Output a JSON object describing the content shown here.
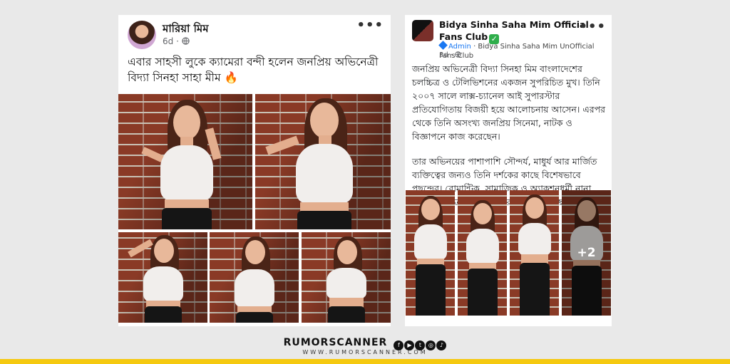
{
  "left_post": {
    "author": "মারিয়া মিম",
    "time": "6d",
    "privacy_icon": "globe-icon",
    "caption": "এবার সাহসী লুকে ক্যামেরা বন্দী হলেন জনপ্রিয় অভিনেত্রী বিদ্যা সিনহা সাহা মীম 🔥"
  },
  "right_post": {
    "page_name": "Bidya Sinha Saha Mim Official Fans Club",
    "verified_mark": "✓",
    "admin_label": "Admin",
    "admin_group": "Bidya Sinha Saha Mim UnOfficial Fans Club",
    "time": "3d",
    "privacy_icon": "globe-icon",
    "paragraph1": "জনপ্রিয় অভিনেত্রী বিদ্যা সিনহা মিম বাংলাদেশের চলচ্চিত্র ও টেলিভিশনের একজন সুপরিচিত মুখ। তিনি ২০০৭ সালে লাক্স-চ্যানেল আই সুপারস্টার প্রতিযোগিতায় বিজয়ী হয়ে আলোচনায় আসেন। এরপর থেকে তিনি অসংখ্য জনপ্রিয় সিনেমা, নাটক ও বিজ্ঞাপনে কাজ করেছেন।",
    "paragraph2": "তার অভিনয়ের পাশাপাশি সৌন্দর্য, মাধুর্য আর মার্জিত ব্যক্তিত্বের জন্যও তিনি দর্শকের কাছে বিশেষভাবে পছন্দের। রোমান্টিক, সামাজিক ও অ্যাকশনধর্মী নানা ধরণের চরিত্রে সমান দক্ষতার প্রমাণ রেখেছেন।",
    "more_photos": "+2"
  },
  "more_icon": "•••",
  "footer": {
    "brand": "RUMORSCANNER",
    "url": "WWW.RUMORSCANNER.COM",
    "social_icons": [
      "facebook-icon",
      "youtube-icon",
      "twitter-icon",
      "instagram-icon",
      "tiktok-icon"
    ]
  },
  "colors": {
    "background": "#e9e9e9",
    "accent_bar": "#f5c90f",
    "link_blue": "#1877f2",
    "verified_green": "#2fae4b"
  }
}
